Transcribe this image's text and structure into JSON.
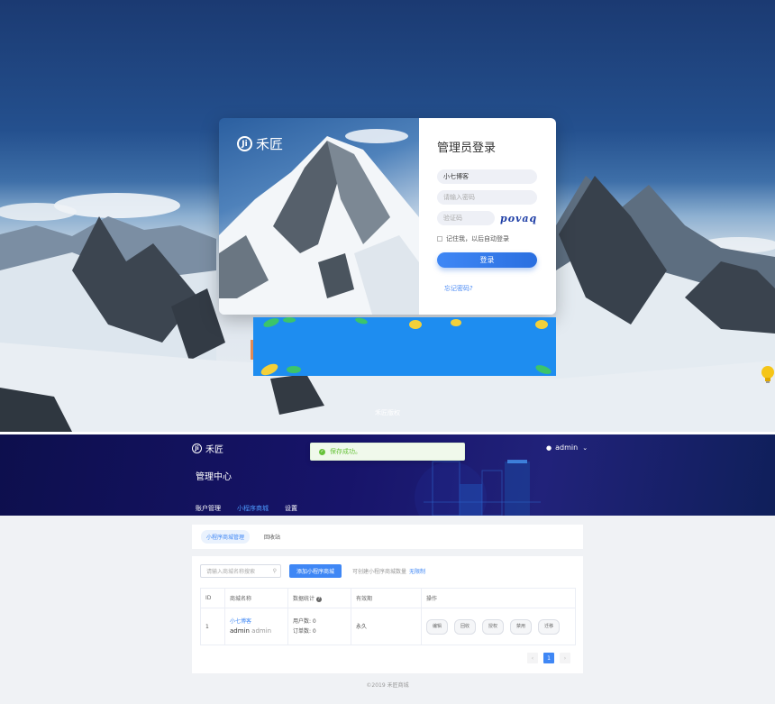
{
  "brand": {
    "logo_text": "Ji",
    "name": "禾匠"
  },
  "login": {
    "title": "管理员登录",
    "username_value": "小七博客",
    "password_placeholder": "请输入密码",
    "captcha_placeholder": "验证码",
    "captcha_text": "povaq",
    "remember_label": "记住我，以后自动登录",
    "submit_label": "登录",
    "forgot_label": "忘记密码?"
  },
  "login_footer": "禾匠版权",
  "admin": {
    "brand_name": "禾匠",
    "page_title": "管理中心",
    "user": {
      "icon": "user-icon",
      "name": "admin"
    },
    "nav": [
      {
        "label": "账户管理"
      },
      {
        "label": "小程序商城"
      },
      {
        "label": "设置"
      }
    ],
    "toast": {
      "icon": "check-circle-icon",
      "text": "保存成功。"
    },
    "sub_tabs": [
      {
        "label": "小程序商城管理"
      },
      {
        "label": "回收站"
      }
    ],
    "search_placeholder": "请输入商城名称搜索",
    "add_button": "添加小程序商城",
    "quota_label": "可创建小程序商城数量",
    "quota_value": "无限制",
    "table": {
      "headers": [
        "ID",
        "商城名称",
        "数据统计",
        "有效期",
        "操作"
      ],
      "rows": [
        {
          "id": "1",
          "name": "小七博客",
          "owner": "admin",
          "owner_sub": "admin",
          "users": "用户数: 0",
          "orders": "订单数: 0",
          "expiry": "永久",
          "actions": [
            "编辑",
            "回收",
            "授权",
            "禁用",
            "迁移"
          ]
        }
      ]
    },
    "pagination": {
      "prev": "‹",
      "current": "1",
      "next": "›"
    }
  },
  "footer": "©2019 禾匠商城",
  "colors": {
    "primary": "#3f87f5",
    "success": "#67c23a",
    "header_bg": "#17146a"
  }
}
